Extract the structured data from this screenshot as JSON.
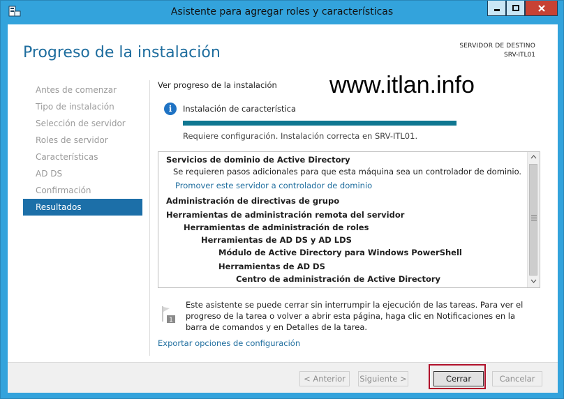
{
  "window": {
    "title": "Asistente para agregar roles y características",
    "accent": "#33a3dc"
  },
  "header": {
    "page_title": "Progreso de la instalación",
    "dest_label": "SERVIDOR DE DESTINO",
    "dest_server": "SRV-ITL01"
  },
  "sidebar": {
    "items": [
      {
        "label": "Antes de comenzar",
        "active": false
      },
      {
        "label": "Tipo de instalación",
        "active": false
      },
      {
        "label": "Selección de servidor",
        "active": false
      },
      {
        "label": "Roles de servidor",
        "active": false
      },
      {
        "label": "Características",
        "active": false
      },
      {
        "label": "AD DS",
        "active": false
      },
      {
        "label": "Confirmación",
        "active": false
      },
      {
        "label": "Resultados",
        "active": true
      }
    ]
  },
  "main": {
    "progress_label": "Ver progreso de la instalación",
    "watermark": "www.itlan.info",
    "feature_status": "Instalación de característica",
    "progress_fraction": 1.0,
    "progress_color": "#0f7791",
    "result_text": "Requiere configuración. Instalación correcta en SRV-ITL01.",
    "results": [
      {
        "text": "Servicios de dominio de Active Directory",
        "level": 0,
        "style": "bold"
      },
      {
        "text": "Se requieren pasos adicionales para que esta máquina sea un controlador de dominio.",
        "level": 0,
        "style": "normal"
      },
      {
        "text": "Promover este servidor a controlador de dominio",
        "level": 0,
        "style": "link"
      },
      {
        "text": "Administración de directivas de grupo",
        "level": 0,
        "style": "bold"
      },
      {
        "text": "Herramientas de administración remota del servidor",
        "level": 0,
        "style": "bold"
      },
      {
        "text": "Herramientas de administración de roles",
        "level": 1,
        "style": "bold"
      },
      {
        "text": "Herramientas de AD DS y AD LDS",
        "level": 2,
        "style": "bold"
      },
      {
        "text": "Módulo de Active Directory para Windows PowerShell",
        "level": 3,
        "style": "bold"
      },
      {
        "text": "Herramientas de AD DS",
        "level": 3,
        "style": "bold"
      },
      {
        "text": "Centro de administración de Active Directory",
        "level": 4,
        "style": "bold"
      }
    ],
    "note": "Este asistente se puede cerrar sin interrumpir la ejecución de las tareas. Para ver el progreso de la tarea o volver a abrir esta página, haga clic en Notificaciones en la barra de comandos y en Detalles de la tarea.",
    "export_link": "Exportar opciones de configuración"
  },
  "footer": {
    "prev_label": "< Anterior",
    "next_label": "Siguiente >",
    "close_label": "Cerrar",
    "cancel_label": "Cancelar",
    "highlight_color": "#b0102a"
  }
}
